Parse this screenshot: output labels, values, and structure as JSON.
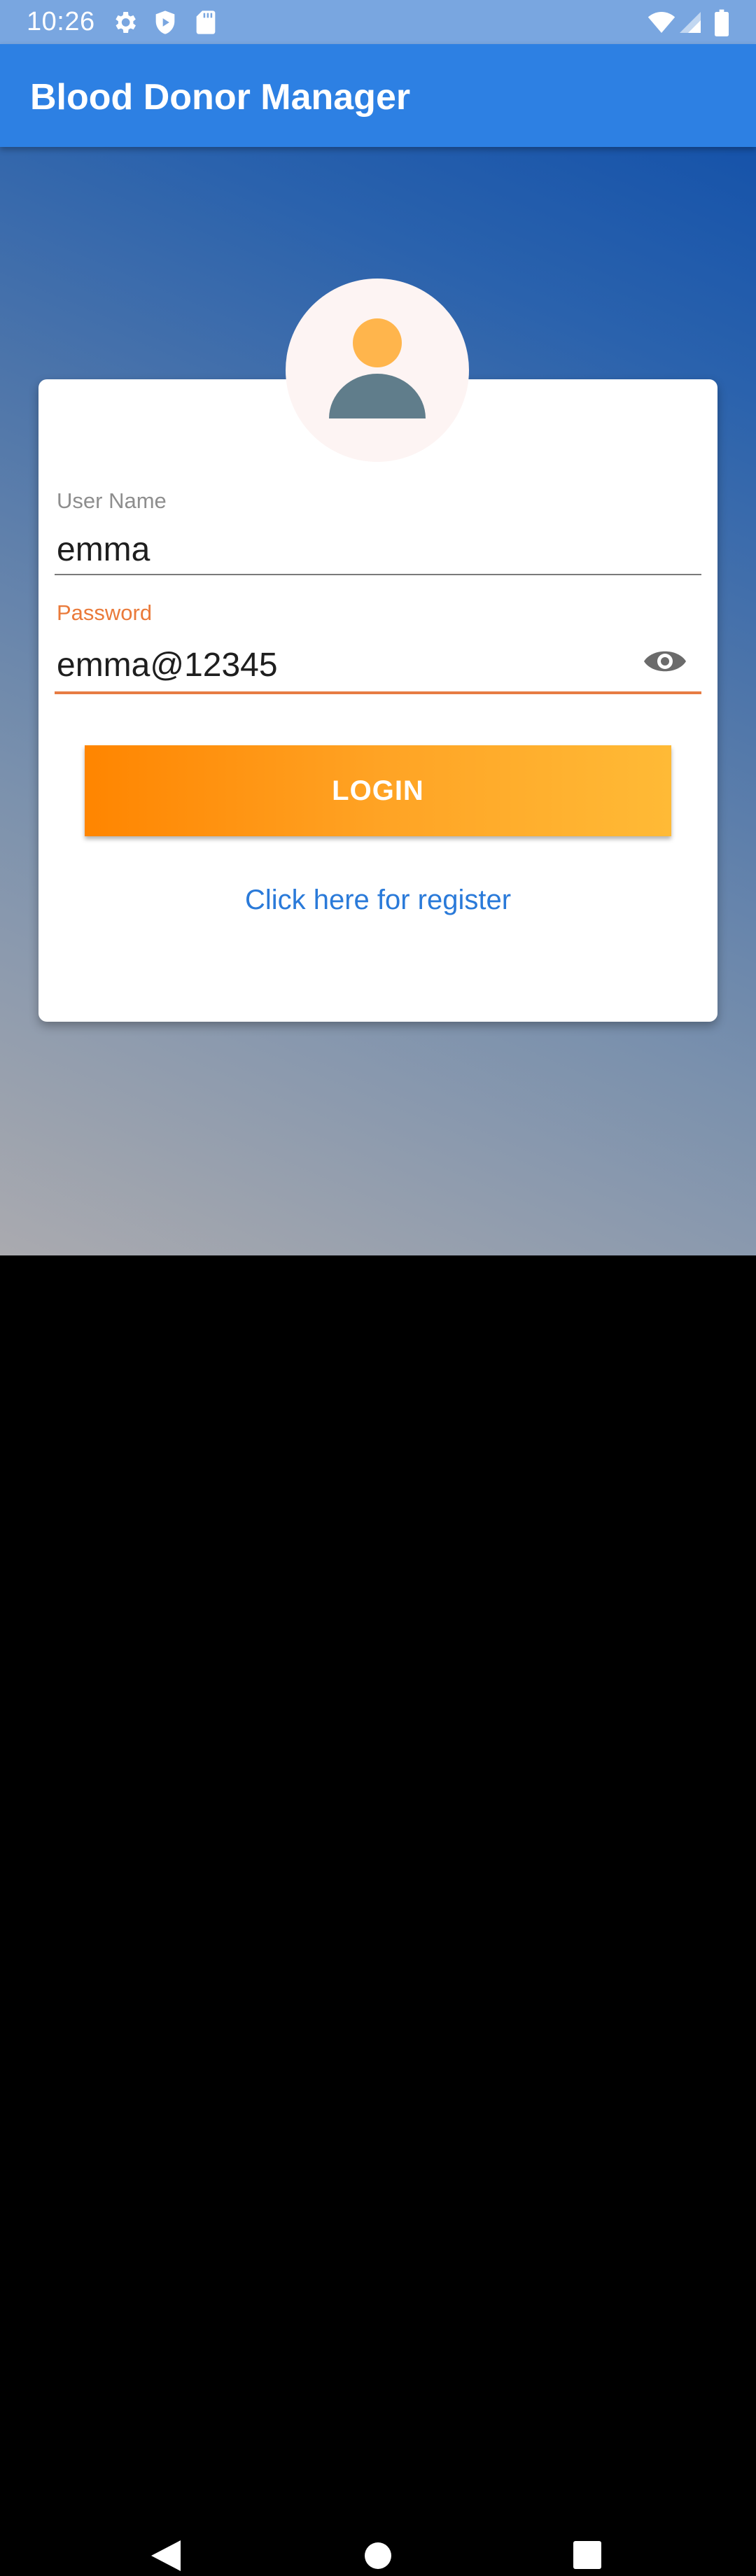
{
  "status_bar": {
    "time": "10:26",
    "icons": [
      "gear-icon",
      "shield-icon",
      "sd-card-icon",
      "wifi-icon",
      "signal-icon",
      "battery-icon"
    ]
  },
  "app_bar": {
    "title": "Blood Donor Manager",
    "color": "#2d80e3"
  },
  "login_form": {
    "avatar_icon": "person-avatar-icon",
    "username": {
      "label": "User Name",
      "value": "emma"
    },
    "password": {
      "label": "Password",
      "value": "emma@12345",
      "visibility_icon": "eye-icon"
    },
    "login_label": "LOGIN",
    "register_link": "Click here for register"
  },
  "colors": {
    "accent": "#e77c43",
    "button_start": "#ff8500",
    "button_end": "#ffba36",
    "link": "#2a7ad9"
  },
  "nav_bar": {
    "buttons": [
      "back-icon",
      "home-icon",
      "recents-icon"
    ]
  }
}
